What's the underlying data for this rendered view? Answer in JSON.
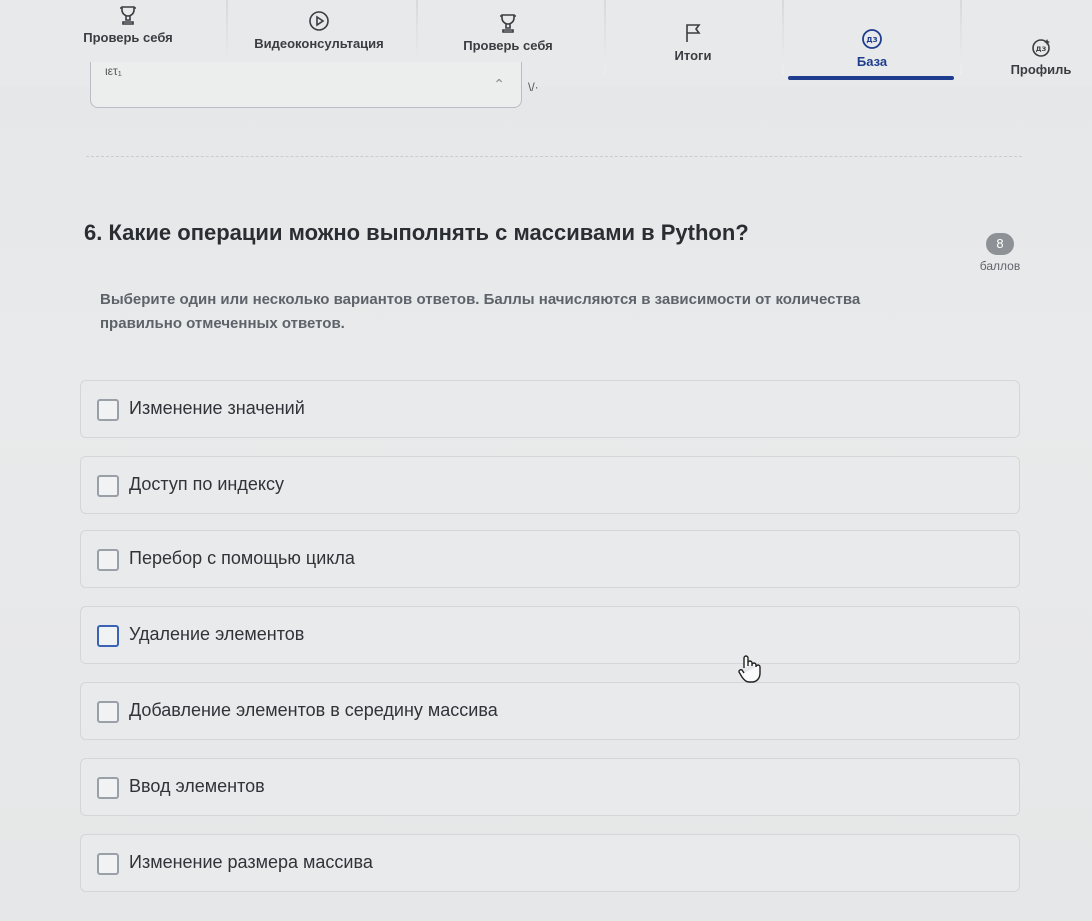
{
  "nav": {
    "items": [
      {
        "label": "Проверь себя",
        "icon": "trophy-icon"
      },
      {
        "label": "Видеоконсультация",
        "icon": "play-icon"
      },
      {
        "label": "Проверь себя",
        "icon": "trophy-icon"
      },
      {
        "label": "Итоги",
        "icon": "flag-icon"
      },
      {
        "label": "База",
        "icon": "dz-icon"
      },
      {
        "label": "Профиль",
        "icon": "dz-profile-icon"
      }
    ],
    "active_index": 4
  },
  "previous_answer": {
    "input_text": "ιετ₁",
    "side_text": "\\/·"
  },
  "question": {
    "title": "6. Какие операции можно выполнять с массивами в Python?",
    "score": "8",
    "score_label": "баллов",
    "hint": "Выберите один или несколько вариантов ответов. Баллы начисляются в зависимости от количества правильно отмеченных ответов."
  },
  "options": [
    {
      "label": "Изменение значений",
      "checked": false
    },
    {
      "label": "Доступ по индексу",
      "checked": false
    },
    {
      "label": "Перебор с помощью цикла",
      "checked": false
    },
    {
      "label": "Удаление элементов",
      "checked": false
    },
    {
      "label": "Добавление элементов в середину массива",
      "checked": false
    },
    {
      "label": "Ввод элементов",
      "checked": false
    },
    {
      "label": "Изменение размера массива",
      "checked": false
    }
  ],
  "colors": {
    "accent": "#1f3d8f",
    "badge": "#8e9297"
  }
}
